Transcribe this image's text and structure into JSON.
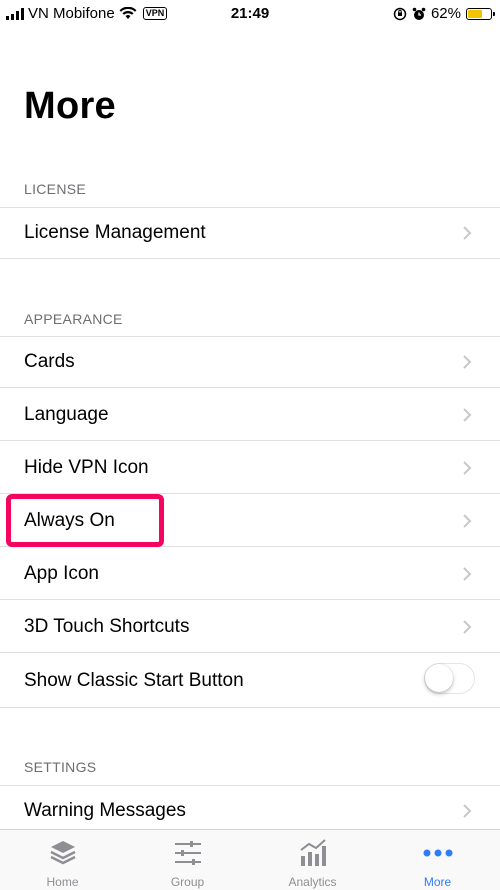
{
  "status_bar": {
    "carrier": "VN Mobifone",
    "vpn": "VPN",
    "time": "21:49",
    "battery": "62%",
    "battery_level": 0.62
  },
  "page": {
    "title": "More"
  },
  "sections": {
    "license": {
      "header": "LICENSE",
      "items": [
        {
          "label": "License Management"
        }
      ]
    },
    "appearance": {
      "header": "APPEARANCE",
      "items": [
        {
          "label": "Cards"
        },
        {
          "label": "Language"
        },
        {
          "label": "Hide VPN Icon"
        },
        {
          "label": "Always On"
        },
        {
          "label": "App Icon"
        },
        {
          "label": "3D Touch Shortcuts"
        },
        {
          "label": "Show Classic Start Button",
          "toggle": false
        }
      ]
    },
    "settings": {
      "header": "SETTINGS",
      "items": [
        {
          "label": "Warning Messages"
        }
      ]
    }
  },
  "tab_bar": {
    "tabs": [
      {
        "label": "Home",
        "icon": "layers-icon"
      },
      {
        "label": "Group",
        "icon": "sliders-icon"
      },
      {
        "label": "Analytics",
        "icon": "analytics-icon"
      },
      {
        "label": "More",
        "icon": "more-dots-icon",
        "active": true
      }
    ]
  },
  "colors": {
    "highlight": "#f5055f",
    "accent": "#2f7cf6",
    "battery": "#f5c400"
  }
}
